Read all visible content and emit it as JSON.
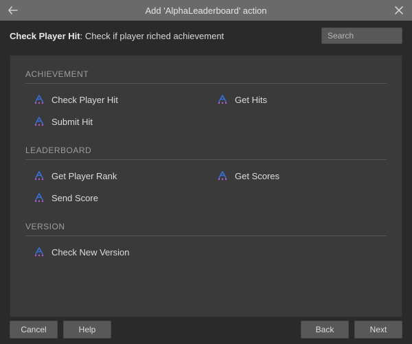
{
  "titlebar": {
    "title": "Add 'AlphaLeaderboard' action"
  },
  "subbar": {
    "selected_name": "Check Player Hit",
    "selected_desc": "Check if player riched achievement"
  },
  "search": {
    "placeholder": "Search",
    "value": ""
  },
  "sections": [
    {
      "title": "ACHIEVEMENT",
      "items": [
        "Check Player Hit",
        "Get Hits",
        "Submit Hit"
      ]
    },
    {
      "title": "LEADERBOARD",
      "items": [
        "Get Player Rank",
        "Get Scores",
        "Send Score"
      ]
    },
    {
      "title": "VERSION",
      "items": [
        "Check New Version"
      ]
    }
  ],
  "footer": {
    "cancel": "Cancel",
    "help": "Help",
    "back": "Back",
    "next": "Next"
  }
}
